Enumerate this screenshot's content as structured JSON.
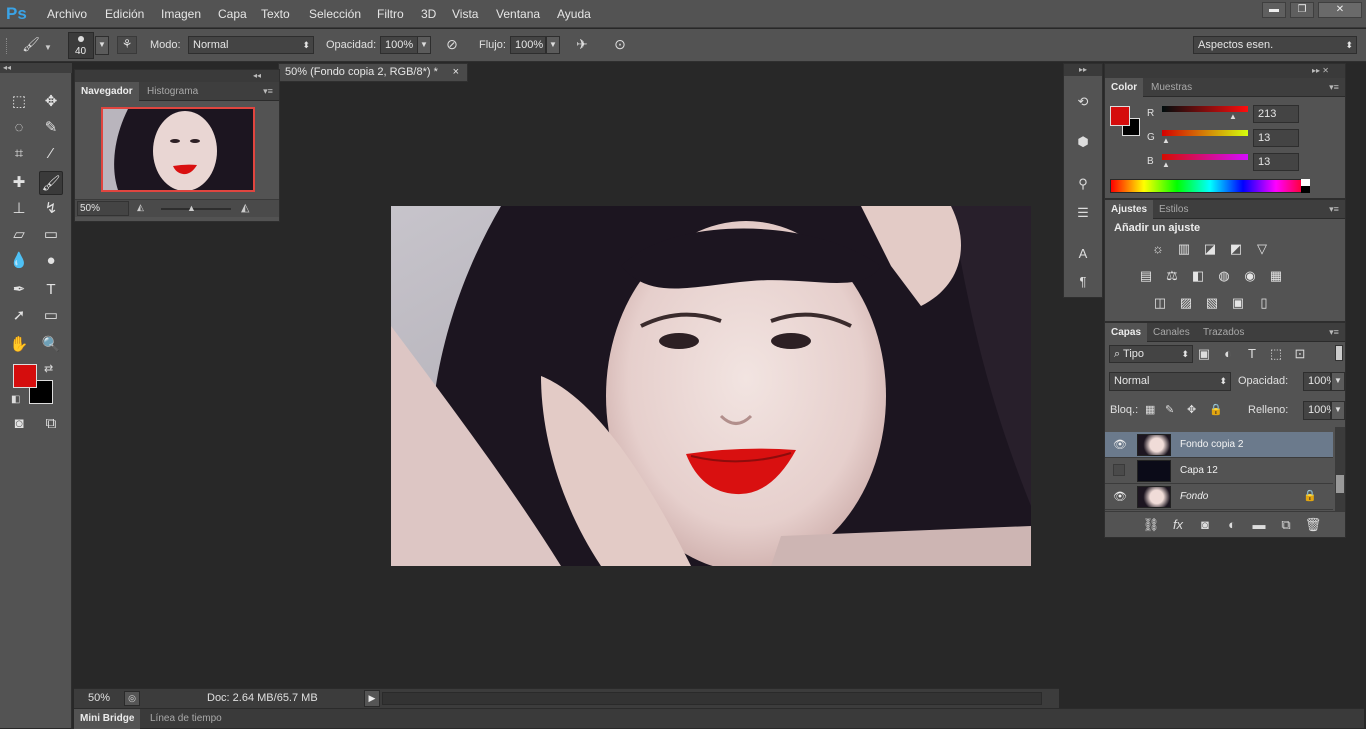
{
  "app": {
    "logo": "Ps",
    "accent": "#3aa3e6"
  },
  "menu": [
    "Archivo",
    "Edición",
    "Imagen",
    "Capa",
    "Texto",
    "Selección",
    "Filtro",
    "3D",
    "Vista",
    "Ventana",
    "Ayuda"
  ],
  "window_controls": {
    "minimize": "▬",
    "restore": "❐",
    "close": "✕"
  },
  "options": {
    "brush_size": "40",
    "mode_label": "Modo:",
    "mode_value": "Normal",
    "opacity_label": "Opacidad:",
    "opacity_value": "100%",
    "flow_label": "Flujo:",
    "flow_value": "100%",
    "workspace": "Aspectos esen."
  },
  "document": {
    "tab_title": "50% (Fondo copia 2, RGB/8*) *",
    "close": "×"
  },
  "navigator": {
    "tabs": [
      "Navegador",
      "Histograma"
    ],
    "zoom": "50%"
  },
  "color_panel": {
    "tabs": [
      "Color",
      "Muestras"
    ],
    "foreground": "#d50d0d",
    "background": "#000000",
    "channels": [
      {
        "label": "R",
        "value": "213"
      },
      {
        "label": "G",
        "value": "13"
      },
      {
        "label": "B",
        "value": "13"
      }
    ]
  },
  "adjustments": {
    "tabs": [
      "Ajustes",
      "Estilos"
    ],
    "heading": "Añadir un ajuste",
    "row1": [
      "☼",
      "▥",
      "◪",
      "◩",
      "▽"
    ],
    "row2": [
      "▤",
      "⚖",
      "◧",
      "◍",
      "◉",
      "▦"
    ],
    "row3": [
      "◫",
      "▨",
      "▧",
      "▣",
      "▯"
    ]
  },
  "layers": {
    "tabs": [
      "Capas",
      "Canales",
      "Trazados"
    ],
    "filter_kind": "Tipo",
    "blend_mode": "Normal",
    "opacity_label": "Opacidad:",
    "opacity_value": "100%",
    "lock_label": "Bloq.:",
    "fill_label": "Relleno:",
    "fill_value": "100%",
    "items": [
      {
        "name": "Fondo copia 2",
        "visible": true,
        "selected": true,
        "locked": false
      },
      {
        "name": "Capa 12",
        "visible": false,
        "selected": false,
        "locked": false
      },
      {
        "name": "Fondo",
        "visible": true,
        "selected": false,
        "locked": true
      }
    ]
  },
  "status": {
    "zoom": "50%",
    "doc_info": "Doc: 2.64 MB/65.7 MB"
  },
  "bottom_tabs": [
    "Mini Bridge",
    "Línea de tiempo"
  ]
}
